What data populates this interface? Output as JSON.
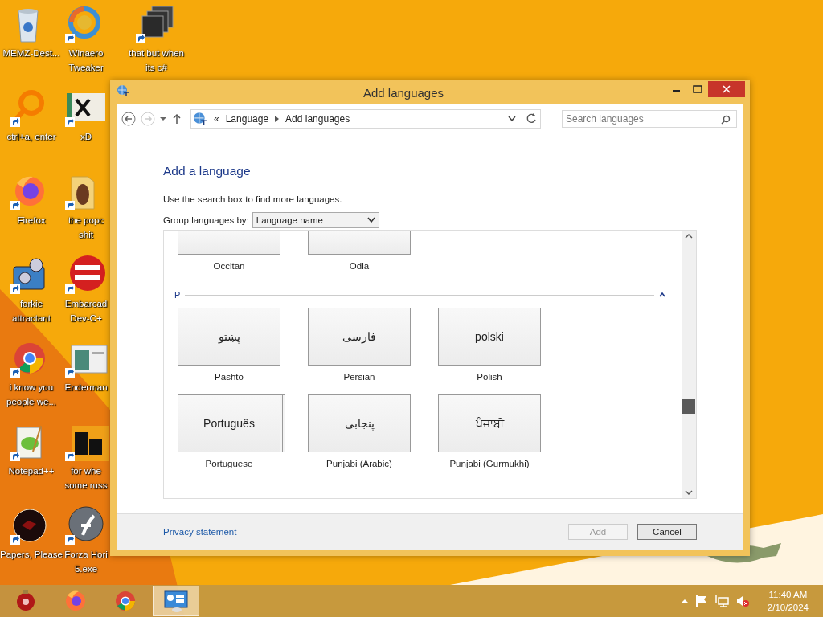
{
  "desktop": {
    "columns": [
      [
        {
          "kind": "bin",
          "lines": [
            "MEMZ-Dest..."
          ]
        },
        {
          "kind": "ring",
          "lines": [
            "ctrl+a, enter"
          ]
        },
        {
          "kind": "fox",
          "lines": [
            "Firefox"
          ]
        },
        {
          "kind": "gears",
          "lines": [
            "forkie",
            "attractant"
          ]
        },
        {
          "kind": "chrome",
          "lines": [
            "i know you",
            "people we..."
          ]
        },
        {
          "kind": "notepad",
          "lines": [
            "Notepad++"
          ]
        },
        {
          "kind": "disc",
          "lines": [
            "Papers, Please"
          ]
        }
      ],
      [
        {
          "kind": "swirl",
          "lines": [
            "Winaero",
            "Tweaker"
          ]
        },
        {
          "kind": "hx",
          "lines": [
            "xD"
          ]
        },
        {
          "kind": "folder",
          "lines": [
            "the popc",
            "shit"
          ]
        },
        {
          "kind": "dev",
          "lines": [
            "Embarcad",
            "Dev-C+"
          ]
        },
        {
          "kind": "screen",
          "lines": [
            "Enderman"
          ]
        },
        {
          "kind": "de",
          "lines": [
            "for whe",
            "some russ"
          ]
        },
        {
          "kind": "flash",
          "lines": [
            "Forza Hori",
            "5.exe"
          ]
        }
      ],
      [
        {
          "kind": "stack",
          "lines": [
            "that but when",
            "its c#"
          ]
        }
      ]
    ]
  },
  "window": {
    "title": "Add languages",
    "address": {
      "parts": [
        "«",
        "Language",
        "Add languages"
      ]
    },
    "search": {
      "placeholder": "Search languages"
    },
    "heading": "Add a language",
    "hint": "Use the search box to find more languages.",
    "group_by": {
      "label": "Group languages by:",
      "value": "Language name"
    },
    "cut_tiles": [
      {
        "name": "Occitan"
      },
      {
        "name": "Odia"
      }
    ],
    "groups": [
      {
        "letter": "P",
        "expanded": true,
        "rows": [
          [
            {
              "native": "پښتو",
              "name": "Pashto",
              "variants": false
            },
            {
              "native": "فارسی",
              "name": "Persian",
              "variants": false
            },
            {
              "native": "polski",
              "name": "Polish",
              "variants": false
            }
          ],
          [
            {
              "native": "Português",
              "name": "Portuguese",
              "variants": true
            },
            {
              "native": "پنجابی",
              "name": "Punjabi (Arabic)",
              "variants": false
            },
            {
              "native": "ਪੰਜਾਬੀ",
              "name": "Punjabi (Gurmukhi)",
              "variants": false
            }
          ]
        ]
      }
    ],
    "privacy_link": "Privacy statement",
    "buttons": [
      {
        "label": "Add",
        "disabled": true
      },
      {
        "label": "Cancel",
        "disabled": false
      }
    ]
  },
  "taskbar": {
    "apps": [
      {
        "kind": "ornament",
        "selected": false
      },
      {
        "kind": "fox",
        "selected": false
      },
      {
        "kind": "chrome",
        "selected": false
      },
      {
        "kind": "panel",
        "selected": true
      }
    ],
    "time": "11:40 AM",
    "date": "2/10/2024"
  }
}
